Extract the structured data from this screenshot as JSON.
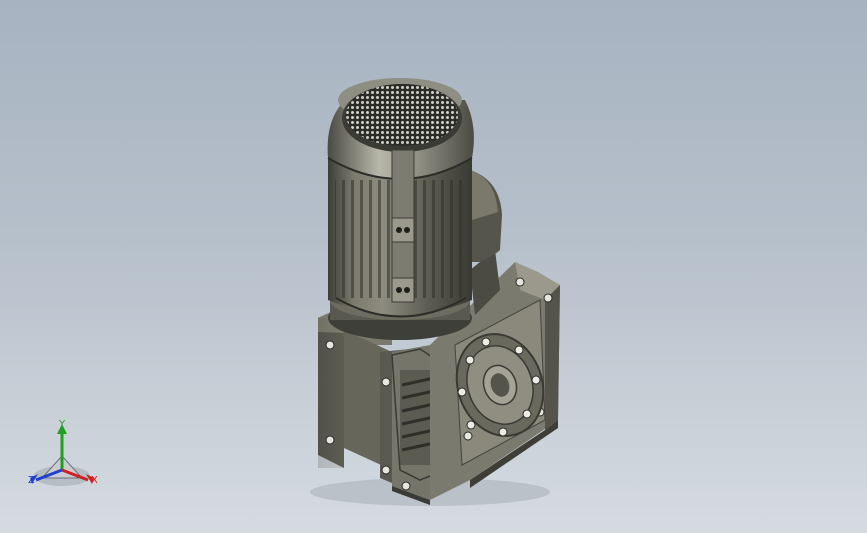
{
  "viewport": {
    "background_top": "#a7b3c1",
    "background_bottom": "#d6dbe1"
  },
  "model": {
    "kind": "gear-motor-assembly",
    "body_color": "#6f6e62",
    "shade_color": "#4a4a42"
  },
  "triad": {
    "x_label": "X",
    "y_label": "Y",
    "z_label": "Z",
    "x_color": "#d02020",
    "y_color": "#20a020",
    "z_color": "#2040d0"
  }
}
